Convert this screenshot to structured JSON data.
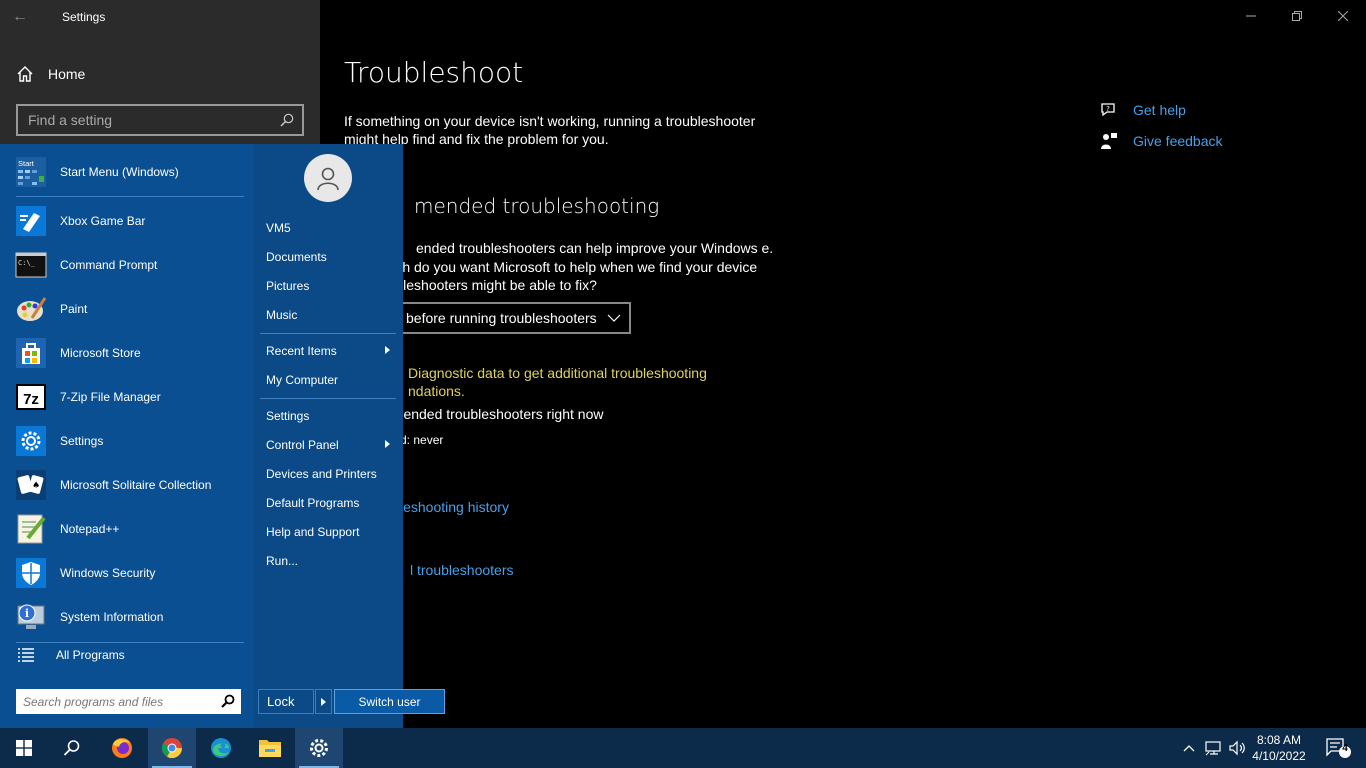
{
  "window": {
    "app_title": "Settings",
    "back_label": "←"
  },
  "nav": {
    "home_label": "Home",
    "search_placeholder": "Find a setting"
  },
  "content": {
    "title": "Troubleshoot",
    "intro": "If something on your device isn't working, running a troubleshooter might help find and fix the problem for you.",
    "recommended_heading": "mended troubleshooting",
    "recommended_desc": "ended troubleshooters can help improve your Windows e. How much do you want Microsoft to help when we find your device that troubleshooters might be able to fix?",
    "dropdown_value": "before running troubleshooters",
    "diagnostic_link": "Diagnostic data to get additional troubleshooting ndations.",
    "run_now": "amended troubleshooters right now",
    "last_run": "d: never",
    "history_link": "leshooting history",
    "additional_link": "l troubleshooters"
  },
  "help": {
    "get_help": "Get help",
    "give_feedback": "Give feedback"
  },
  "start_menu": {
    "apps": [
      {
        "label": "Start Menu (Windows)",
        "icon": "start-menu-app-icon"
      },
      {
        "label": "Xbox Game Bar",
        "icon": "xbox-game-bar-icon"
      },
      {
        "label": "Command Prompt",
        "icon": "command-prompt-icon"
      },
      {
        "label": "Paint",
        "icon": "paint-icon"
      },
      {
        "label": "Microsoft Store",
        "icon": "microsoft-store-icon"
      },
      {
        "label": "7-Zip File Manager",
        "icon": "7zip-icon"
      },
      {
        "label": "Settings",
        "icon": "settings-gear-icon"
      },
      {
        "label": "Microsoft Solitaire Collection",
        "icon": "solitaire-icon"
      },
      {
        "label": "Notepad++",
        "icon": "notepad-plus-plus-icon"
      },
      {
        "label": "Windows Security",
        "icon": "windows-security-icon"
      },
      {
        "label": "System Information",
        "icon": "system-information-icon"
      }
    ],
    "start_icon_text": "Start",
    "cmd_icon_text": "C:\\_",
    "zip_icon_text": "7z",
    "all_programs": "All Programs",
    "search_placeholder": "Search programs and files",
    "right_items": [
      {
        "label": "VM5"
      },
      {
        "label": "Documents"
      },
      {
        "label": "Pictures"
      },
      {
        "label": "Music"
      },
      {
        "label": "Recent Items"
      },
      {
        "label": "My Computer"
      },
      {
        "label": "Settings"
      },
      {
        "label": "Control Panel"
      },
      {
        "label": "Devices and Printers"
      },
      {
        "label": "Default Programs"
      },
      {
        "label": "Help and Support"
      },
      {
        "label": "Run..."
      }
    ],
    "lock_label": "Lock",
    "switch_user_label": "Switch user"
  },
  "taskbar": {
    "time": "8:08 AM",
    "date": "4/10/2022",
    "notification_count": "4",
    "pinned": [
      "windows-start-icon",
      "search-icon",
      "firefox-icon",
      "chrome-icon",
      "edge-icon",
      "file-explorer-icon",
      "settings-gear-icon"
    ]
  },
  "colors": {
    "accent_link": "#4a9fe8",
    "warning_link": "#e0d060",
    "start_menu_bg": "#0a4f92",
    "taskbar_bg": "#0c2a4a"
  }
}
